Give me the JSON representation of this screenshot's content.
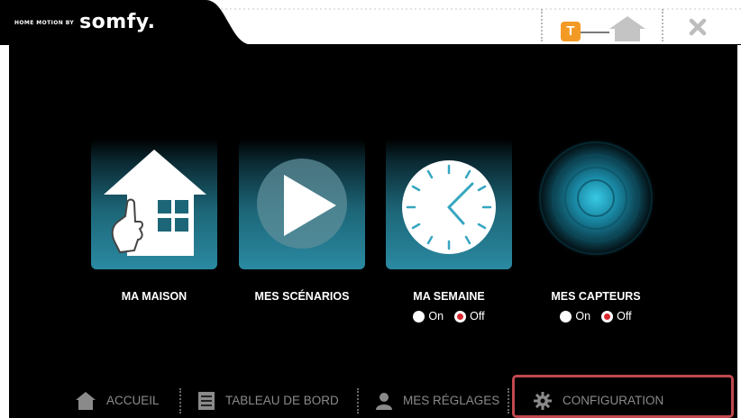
{
  "brand": {
    "tagline": "HOME MOTION BY",
    "logo": "somfy."
  },
  "header_buttons": [
    {
      "icon": "t-orange-badge-icon",
      "label": "T"
    },
    {
      "icon": "home-icon"
    },
    {
      "icon": "close-icon"
    }
  ],
  "tiles": [
    {
      "label": "MA MAISON",
      "icon": "house-hand-icon"
    },
    {
      "label": "MES SCÉNARIOS",
      "icon": "play-icon"
    },
    {
      "label": "MA SEMAINE",
      "icon": "clock-icon",
      "toggle": {
        "on_label": "On",
        "off_label": "Off",
        "selected": "Off"
      }
    },
    {
      "label": "MES CAPTEURS",
      "icon": "sensor-glow-icon",
      "toggle": {
        "on_label": "On",
        "off_label": "Off",
        "selected": "Off"
      }
    }
  ],
  "nav": [
    {
      "label": "ACCUEIL",
      "icon": "home-icon"
    },
    {
      "label": "TABLEAU DE BORD",
      "icon": "dashboard-icon"
    },
    {
      "label": "MES RÉGLAGES",
      "icon": "user-icon"
    },
    {
      "label": "CONFIGURATION",
      "icon": "gear-icon",
      "highlighted": true
    }
  ],
  "colors": {
    "accent_orange": "#f39a24",
    "tile_teal": "#2a8aa2",
    "radio_selected": "#d8262e",
    "highlight_border": "#c0484e"
  }
}
